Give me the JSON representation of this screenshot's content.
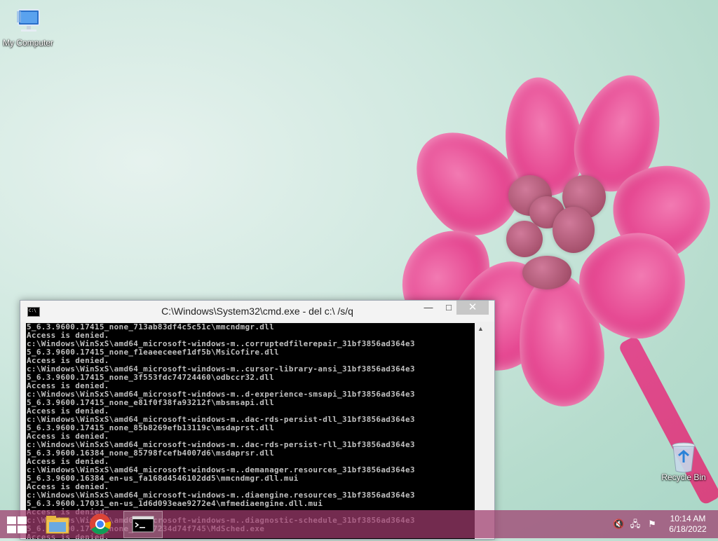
{
  "desktop": {
    "icons": [
      {
        "label": "My Computer",
        "icon": "computer-icon"
      },
      {
        "label": "Recycle Bin",
        "icon": "recycle-bin-icon"
      }
    ]
  },
  "cmd_window": {
    "title": "C:\\Windows\\System32\\cmd.exe - del  c:\\ /s/q",
    "minimize_label": "—",
    "maximize_label": "□",
    "close_label": "✕",
    "lines": [
      "5_6.3.9600.17415_none_713ab83df4c5c51c\\mmcndmgr.dll",
      "Access is denied.",
      "c:\\Windows\\WinSxS\\amd64_microsoft-windows-m..corruptedfilerepair_31bf3856ad364e3",
      "5_6.3.9600.17415_none_f1eaeeceeef1df5b\\MsiCofire.dll",
      "Access is denied.",
      "c:\\Windows\\WinSxS\\amd64_microsoft-windows-m..cursor-library-ansi_31bf3856ad364e3",
      "5_6.3.9600.17415_none_3f553fdc74724460\\odbccr32.dll",
      "Access is denied.",
      "c:\\Windows\\WinSxS\\amd64_microsoft-windows-m..d-experience-smsapi_31bf3856ad364e3",
      "5_6.3.9600.17415_none_e81f0f38fa93212f\\mbsmsapi.dll",
      "Access is denied.",
      "c:\\Windows\\WinSxS\\amd64_microsoft-windows-m..dac-rds-persist-dll_31bf3856ad364e3",
      "5_6.3.9600.17415_none_85b8269efb13119c\\msdaprst.dll",
      "Access is denied.",
      "c:\\Windows\\WinSxS\\amd64_microsoft-windows-m..dac-rds-persist-rll_31bf3856ad364e3",
      "5_6.3.9600.16384_none_85798fcefb4007d6\\msdaprsr.dll",
      "Access is denied.",
      "c:\\Windows\\WinSxS\\amd64_microsoft-windows-m..demanager.resources_31bf3856ad364e3",
      "5_6.3.9600.16384_en-us_fa168d4546102dd5\\mmcndmgr.dll.mui",
      "Access is denied.",
      "c:\\Windows\\WinSxS\\amd64_microsoft-windows-m..diaengine.resources_31bf3856ad364e3",
      "5_6.3.9600.17031_en-us_1d6d093eae9272e4\\mfmediaengine.dll.mui",
      "Access is denied.",
      "c:\\Windows\\WinSxS\\amd64_microsoft-windows-m..diagnostic-schedule_31bf3856ad364e3",
      "5_6.3.9600.17415_none_4e197234d74f745\\MdSched.exe",
      "Access is denied."
    ]
  },
  "taskbar": {
    "apps": [
      {
        "name": "file-explorer"
      },
      {
        "name": "chrome"
      },
      {
        "name": "command-prompt"
      }
    ],
    "clock": {
      "time": "10:14 AM",
      "date": "6/18/2022"
    }
  },
  "colors": {
    "taskbar": "#a03c6e",
    "console_bg": "#000000",
    "console_text": "#c0c0c0",
    "petal": "#e64a93"
  }
}
